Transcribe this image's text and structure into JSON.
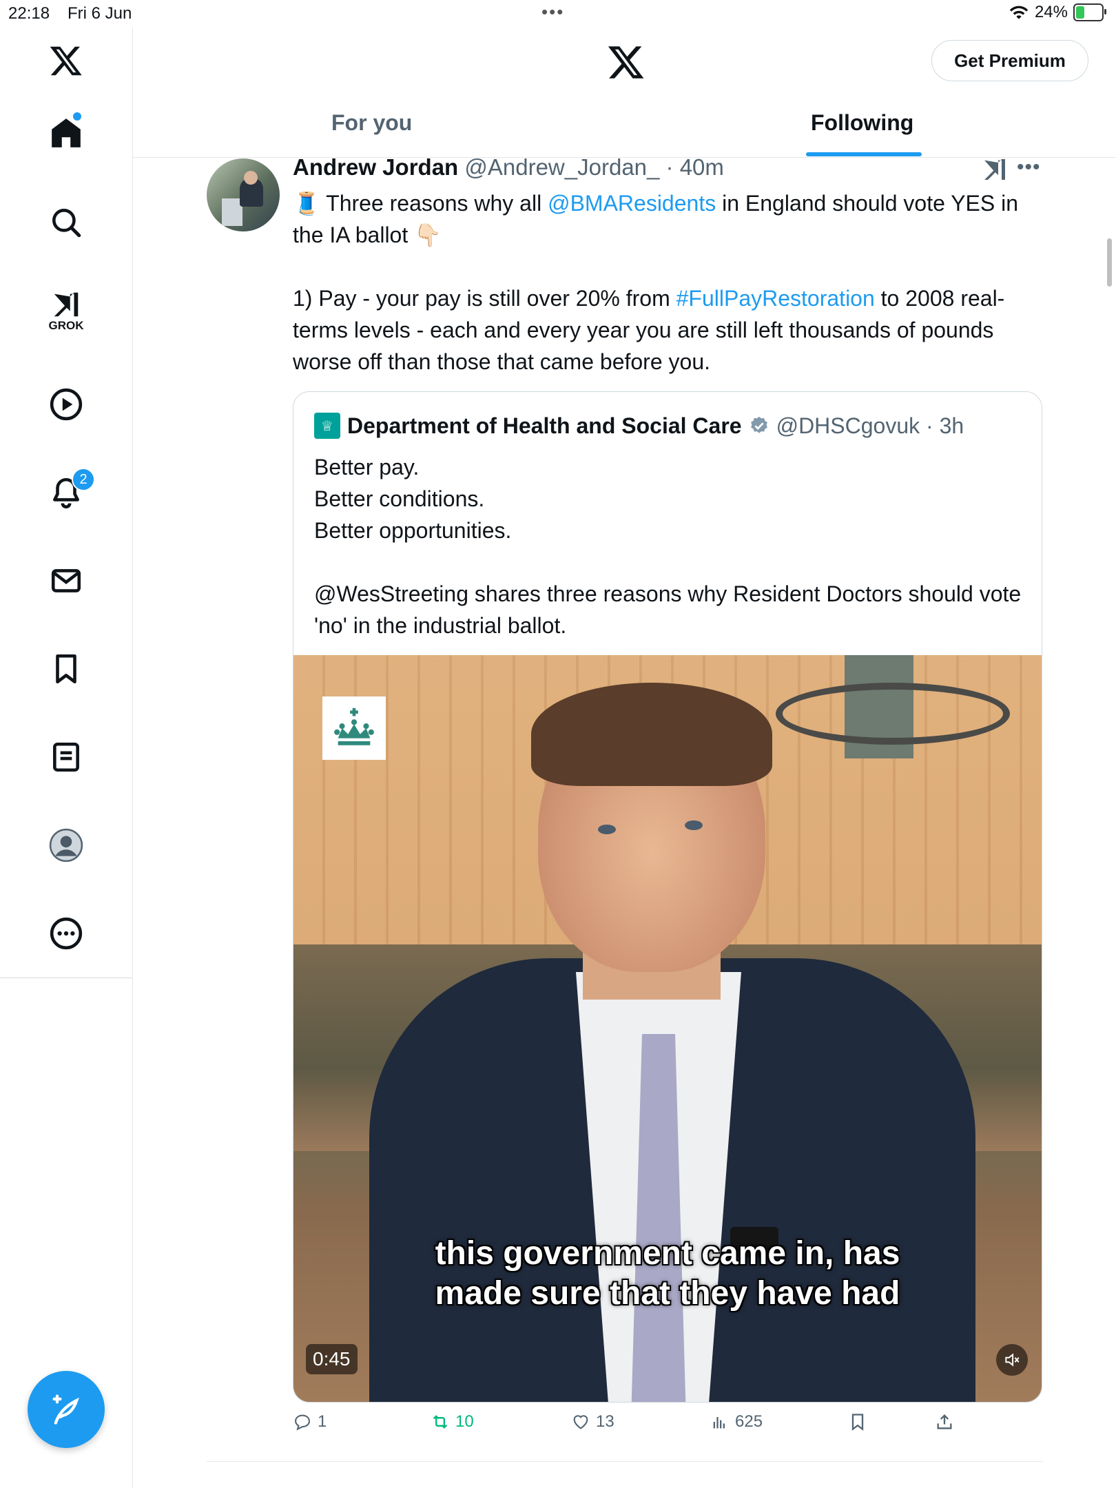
{
  "status_bar": {
    "time": "22:18",
    "date": "Fri 6 Jun",
    "battery": "24%"
  },
  "sidebar": {
    "items": [
      {
        "name": "x-logo"
      },
      {
        "name": "home",
        "has_dot": true
      },
      {
        "name": "search"
      },
      {
        "name": "grok",
        "label": "GROK"
      },
      {
        "name": "videos"
      },
      {
        "name": "notifications",
        "badge": "2"
      },
      {
        "name": "messages"
      },
      {
        "name": "bookmarks"
      },
      {
        "name": "lists"
      },
      {
        "name": "profile"
      },
      {
        "name": "more"
      }
    ]
  },
  "header": {
    "premium_label": "Get Premium",
    "tabs": [
      {
        "label": "For you",
        "active": false
      },
      {
        "label": "Following",
        "active": true
      }
    ]
  },
  "post": {
    "author_name": "Andrew Jordan",
    "meta": "@Andrew_Jordan_ · 40m",
    "text": {
      "line1_pre": "🧵 Three reasons why all ",
      "mention": "@BMAResidents",
      "line1_post": " in England should vote YES in the IA ballot 👇🏻",
      "para2_pre": "1) Pay - your pay is still over 20% from ",
      "hashtag": "#FullPayRestoration",
      "para2_post": " to 2008 real-terms levels - each and every year you are still left thousands of pounds worse off than those that came before you."
    },
    "quoted": {
      "name": "Department of Health and Social Care",
      "meta": "@DHSCgovuk · 3h",
      "lines": [
        "Better pay.",
        "Better conditions.",
        "Better opportunities."
      ],
      "para2": "@WesStreeting shares three reasons why Resident Doctors should vote 'no' in the industrial ballot.",
      "video": {
        "caption_line1": "this government came in, has",
        "caption_line2": "made sure that they have had",
        "duration": "0:45"
      }
    },
    "actions": {
      "replies": "1",
      "reposts": "10",
      "likes": "13",
      "views": "625"
    }
  },
  "colors": {
    "accent": "#1d9bf0",
    "repost": "#00ba7c",
    "muted": "#536471"
  }
}
